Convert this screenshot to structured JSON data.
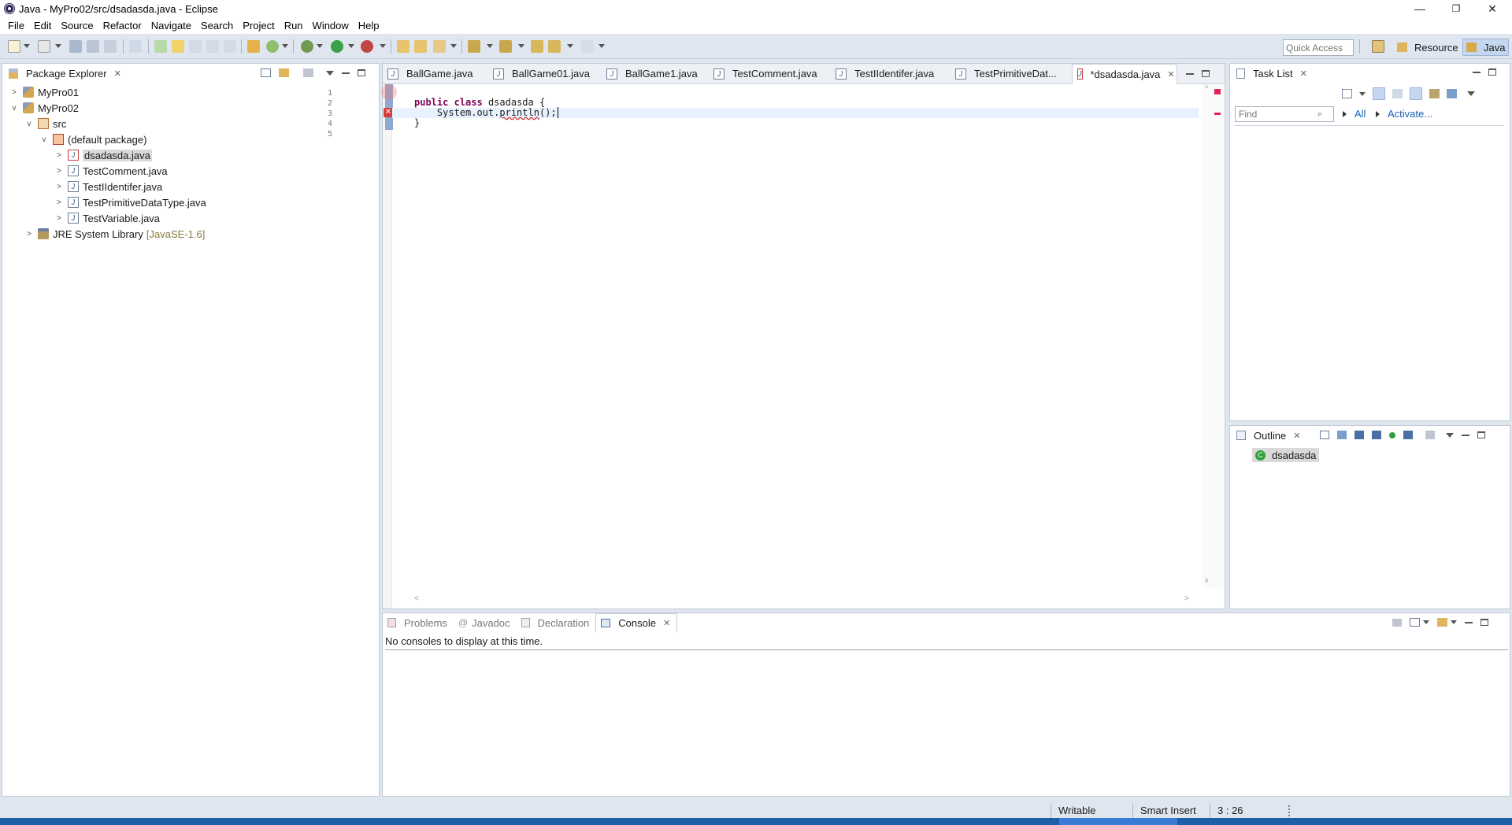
{
  "window": {
    "title": "Java - MyPro02/src/dsadasda.java - Eclipse",
    "controls": [
      "—",
      "❐",
      "✕"
    ]
  },
  "menu": [
    "File",
    "Edit",
    "Source",
    "Refactor",
    "Navigate",
    "Search",
    "Project",
    "Run",
    "Window",
    "Help"
  ],
  "toolbar": {
    "quick_access_placeholder": "Quick Access",
    "perspective_resource": "Resource",
    "perspective_java": "Java"
  },
  "package_explorer": {
    "title": "Package Explorer",
    "tree": [
      {
        "label": "MyPro01",
        "expanded": false
      },
      {
        "label": "MyPro02",
        "expanded": true
      },
      {
        "label": "src",
        "expanded": true
      },
      {
        "label": "(default package)",
        "expanded": true
      },
      {
        "label": "dsadasda.java",
        "selected": true
      },
      {
        "label": "TestComment.java"
      },
      {
        "label": "TestIIdentifer.java"
      },
      {
        "label": "TestPrimitiveDataType.java"
      },
      {
        "label": "TestVariable.java"
      },
      {
        "label": "JRE System Library",
        "suffix": "[JavaSE-1.6]"
      }
    ]
  },
  "editor": {
    "tabs": [
      "BallGame.java",
      "BallGame01.java",
      "BallGame1.java",
      "TestComment.java",
      "TestIIdentifer.java",
      "TestPrimitiveDat...",
      "*dsadasda.java"
    ],
    "active_tab": "*dsadasda.java",
    "line_numbers": [
      "1",
      "2",
      "3",
      "4",
      "5"
    ],
    "lines": [
      "",
      "public class dsadasda {",
      "    System.out.println();",
      "}",
      ""
    ],
    "kw_public": "public",
    "kw_class": "class",
    "class_name": " dsadasda {",
    "stmt_prefix": "    System.out.",
    "stmt_call": "println",
    "stmt_suffix": "();"
  },
  "task_list": {
    "title": "Task List",
    "find_placeholder": "Find",
    "all_label": "All",
    "activate_label": "Activate..."
  },
  "outline": {
    "title": "Outline",
    "item": "dsadasda"
  },
  "bottom_panel": {
    "tabs": [
      "Problems",
      "Javadoc",
      "Declaration",
      "Console"
    ],
    "active_tab": "Console",
    "message": "No consoles to display at this time."
  },
  "status": {
    "writable": "Writable",
    "insert_mode": "Smart Insert",
    "position": "3 : 26"
  }
}
